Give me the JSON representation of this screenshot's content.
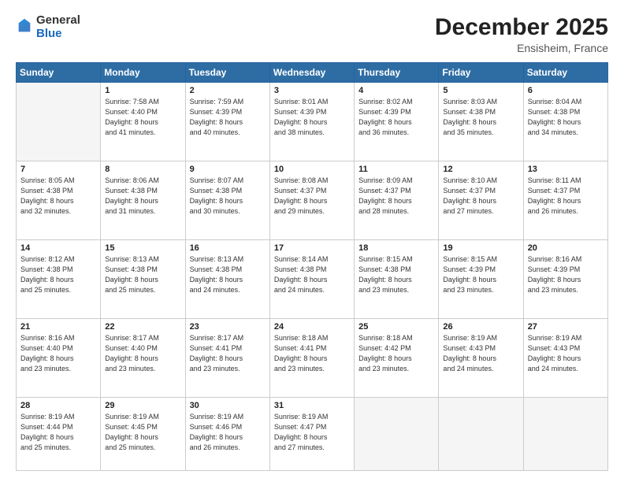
{
  "logo": {
    "general": "General",
    "blue": "Blue"
  },
  "title": "December 2025",
  "subtitle": "Ensisheim, France",
  "days_header": [
    "Sunday",
    "Monday",
    "Tuesday",
    "Wednesday",
    "Thursday",
    "Friday",
    "Saturday"
  ],
  "weeks": [
    [
      {
        "day": "",
        "sunrise": "",
        "sunset": "",
        "daylight": ""
      },
      {
        "day": "1",
        "sunrise": "Sunrise: 7:58 AM",
        "sunset": "Sunset: 4:40 PM",
        "daylight": "Daylight: 8 hours and 41 minutes."
      },
      {
        "day": "2",
        "sunrise": "Sunrise: 7:59 AM",
        "sunset": "Sunset: 4:39 PM",
        "daylight": "Daylight: 8 hours and 40 minutes."
      },
      {
        "day": "3",
        "sunrise": "Sunrise: 8:01 AM",
        "sunset": "Sunset: 4:39 PM",
        "daylight": "Daylight: 8 hours and 38 minutes."
      },
      {
        "day": "4",
        "sunrise": "Sunrise: 8:02 AM",
        "sunset": "Sunset: 4:39 PM",
        "daylight": "Daylight: 8 hours and 36 minutes."
      },
      {
        "day": "5",
        "sunrise": "Sunrise: 8:03 AM",
        "sunset": "Sunset: 4:38 PM",
        "daylight": "Daylight: 8 hours and 35 minutes."
      },
      {
        "day": "6",
        "sunrise": "Sunrise: 8:04 AM",
        "sunset": "Sunset: 4:38 PM",
        "daylight": "Daylight: 8 hours and 34 minutes."
      }
    ],
    [
      {
        "day": "7",
        "sunrise": "Sunrise: 8:05 AM",
        "sunset": "Sunset: 4:38 PM",
        "daylight": "Daylight: 8 hours and 32 minutes."
      },
      {
        "day": "8",
        "sunrise": "Sunrise: 8:06 AM",
        "sunset": "Sunset: 4:38 PM",
        "daylight": "Daylight: 8 hours and 31 minutes."
      },
      {
        "day": "9",
        "sunrise": "Sunrise: 8:07 AM",
        "sunset": "Sunset: 4:38 PM",
        "daylight": "Daylight: 8 hours and 30 minutes."
      },
      {
        "day": "10",
        "sunrise": "Sunrise: 8:08 AM",
        "sunset": "Sunset: 4:37 PM",
        "daylight": "Daylight: 8 hours and 29 minutes."
      },
      {
        "day": "11",
        "sunrise": "Sunrise: 8:09 AM",
        "sunset": "Sunset: 4:37 PM",
        "daylight": "Daylight: 8 hours and 28 minutes."
      },
      {
        "day": "12",
        "sunrise": "Sunrise: 8:10 AM",
        "sunset": "Sunset: 4:37 PM",
        "daylight": "Daylight: 8 hours and 27 minutes."
      },
      {
        "day": "13",
        "sunrise": "Sunrise: 8:11 AM",
        "sunset": "Sunset: 4:37 PM",
        "daylight": "Daylight: 8 hours and 26 minutes."
      }
    ],
    [
      {
        "day": "14",
        "sunrise": "Sunrise: 8:12 AM",
        "sunset": "Sunset: 4:38 PM",
        "daylight": "Daylight: 8 hours and 25 minutes."
      },
      {
        "day": "15",
        "sunrise": "Sunrise: 8:13 AM",
        "sunset": "Sunset: 4:38 PM",
        "daylight": "Daylight: 8 hours and 25 minutes."
      },
      {
        "day": "16",
        "sunrise": "Sunrise: 8:13 AM",
        "sunset": "Sunset: 4:38 PM",
        "daylight": "Daylight: 8 hours and 24 minutes."
      },
      {
        "day": "17",
        "sunrise": "Sunrise: 8:14 AM",
        "sunset": "Sunset: 4:38 PM",
        "daylight": "Daylight: 8 hours and 24 minutes."
      },
      {
        "day": "18",
        "sunrise": "Sunrise: 8:15 AM",
        "sunset": "Sunset: 4:38 PM",
        "daylight": "Daylight: 8 hours and 23 minutes."
      },
      {
        "day": "19",
        "sunrise": "Sunrise: 8:15 AM",
        "sunset": "Sunset: 4:39 PM",
        "daylight": "Daylight: 8 hours and 23 minutes."
      },
      {
        "day": "20",
        "sunrise": "Sunrise: 8:16 AM",
        "sunset": "Sunset: 4:39 PM",
        "daylight": "Daylight: 8 hours and 23 minutes."
      }
    ],
    [
      {
        "day": "21",
        "sunrise": "Sunrise: 8:16 AM",
        "sunset": "Sunset: 4:40 PM",
        "daylight": "Daylight: 8 hours and 23 minutes."
      },
      {
        "day": "22",
        "sunrise": "Sunrise: 8:17 AM",
        "sunset": "Sunset: 4:40 PM",
        "daylight": "Daylight: 8 hours and 23 minutes."
      },
      {
        "day": "23",
        "sunrise": "Sunrise: 8:17 AM",
        "sunset": "Sunset: 4:41 PM",
        "daylight": "Daylight: 8 hours and 23 minutes."
      },
      {
        "day": "24",
        "sunrise": "Sunrise: 8:18 AM",
        "sunset": "Sunset: 4:41 PM",
        "daylight": "Daylight: 8 hours and 23 minutes."
      },
      {
        "day": "25",
        "sunrise": "Sunrise: 8:18 AM",
        "sunset": "Sunset: 4:42 PM",
        "daylight": "Daylight: 8 hours and 23 minutes."
      },
      {
        "day": "26",
        "sunrise": "Sunrise: 8:19 AM",
        "sunset": "Sunset: 4:43 PM",
        "daylight": "Daylight: 8 hours and 24 minutes."
      },
      {
        "day": "27",
        "sunrise": "Sunrise: 8:19 AM",
        "sunset": "Sunset: 4:43 PM",
        "daylight": "Daylight: 8 hours and 24 minutes."
      }
    ],
    [
      {
        "day": "28",
        "sunrise": "Sunrise: 8:19 AM",
        "sunset": "Sunset: 4:44 PM",
        "daylight": "Daylight: 8 hours and 25 minutes."
      },
      {
        "day": "29",
        "sunrise": "Sunrise: 8:19 AM",
        "sunset": "Sunset: 4:45 PM",
        "daylight": "Daylight: 8 hours and 25 minutes."
      },
      {
        "day": "30",
        "sunrise": "Sunrise: 8:19 AM",
        "sunset": "Sunset: 4:46 PM",
        "daylight": "Daylight: 8 hours and 26 minutes."
      },
      {
        "day": "31",
        "sunrise": "Sunrise: 8:19 AM",
        "sunset": "Sunset: 4:47 PM",
        "daylight": "Daylight: 8 hours and 27 minutes."
      },
      {
        "day": "",
        "sunrise": "",
        "sunset": "",
        "daylight": ""
      },
      {
        "day": "",
        "sunrise": "",
        "sunset": "",
        "daylight": ""
      },
      {
        "day": "",
        "sunrise": "",
        "sunset": "",
        "daylight": ""
      }
    ]
  ]
}
